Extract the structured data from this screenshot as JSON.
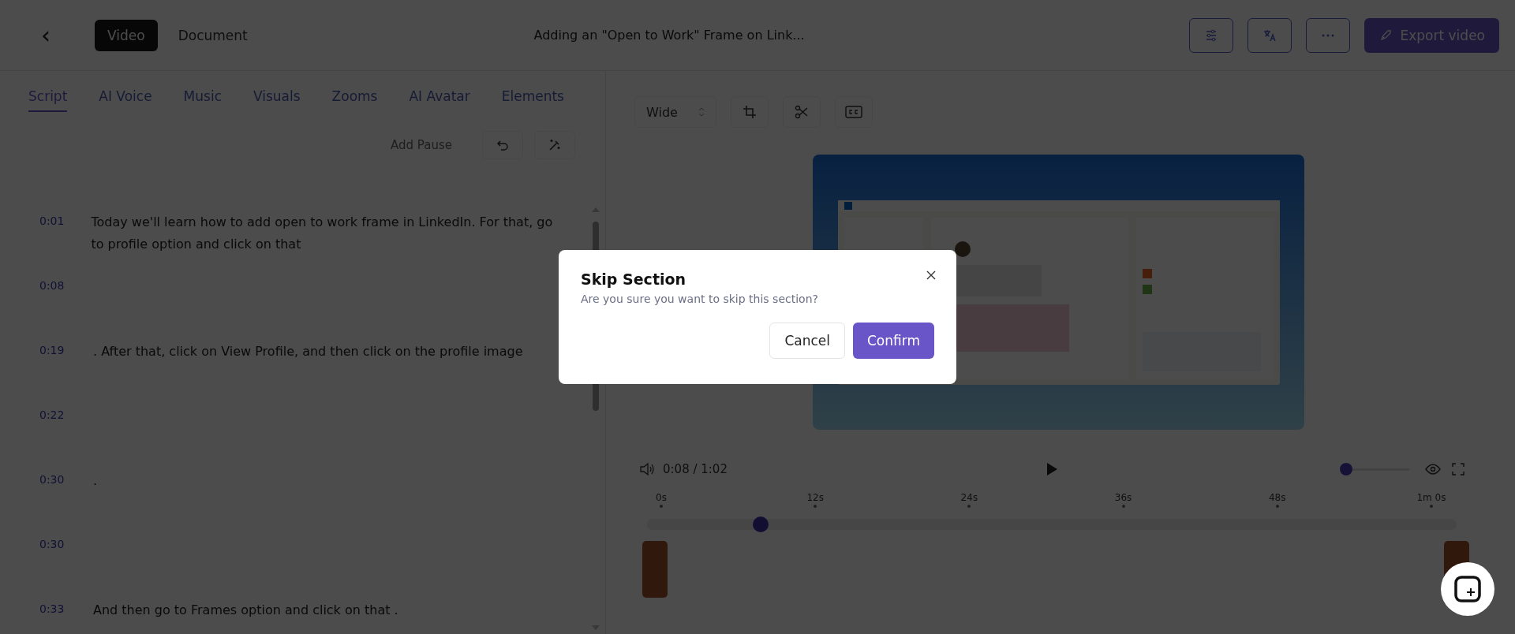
{
  "header": {
    "back": "‹",
    "view_tabs": [
      {
        "label": "Video",
        "selected": true
      },
      {
        "label": "Document",
        "selected": false
      }
    ],
    "title": "Adding an \"Open to Work\" Frame on Link...",
    "export_label": "Export video"
  },
  "editor_tabs": [
    {
      "label": "Script",
      "selected": true
    },
    {
      "label": "AI Voice",
      "selected": false
    },
    {
      "label": "Music",
      "selected": false
    },
    {
      "label": "Visuals",
      "selected": false
    },
    {
      "label": "Zooms",
      "selected": false
    },
    {
      "label": "AI Avatar",
      "selected": false
    },
    {
      "label": "Elements",
      "selected": false
    }
  ],
  "script_toolbar": {
    "add_pause": "Add Pause"
  },
  "script_rows": [
    {
      "time": "0:01",
      "text": "Today we'll learn how to add open to work frame in LinkedIn. For that, go to profile option and click on that"
    },
    {
      "time": "0:08",
      "text": ""
    },
    {
      "time": "0:19",
      "text": ". After that, click on View Profile, and then click on the profile image"
    },
    {
      "time": "0:22",
      "text": ""
    },
    {
      "time": "0:30",
      "text": "."
    },
    {
      "time": "0:30",
      "text": ""
    },
    {
      "time": "0:33",
      "text": "And then go to Frames option and click on that ."
    }
  ],
  "preview": {
    "aspect": "Wide"
  },
  "player": {
    "time": "0:08 / 1:02",
    "zoom": {
      "level": 0.05
    },
    "ticks": [
      "0s",
      "12s",
      "24s",
      "36s",
      "48s",
      "1m 0s"
    ],
    "playhead": {
      "level": 0.14
    }
  },
  "dialog": {
    "title": "Skip Section",
    "message": "Are you sure you want to skip this section?",
    "buttons": [
      {
        "label": "Cancel",
        "kind": "secondary"
      },
      {
        "label": "Confirm",
        "kind": "primary"
      }
    ]
  }
}
